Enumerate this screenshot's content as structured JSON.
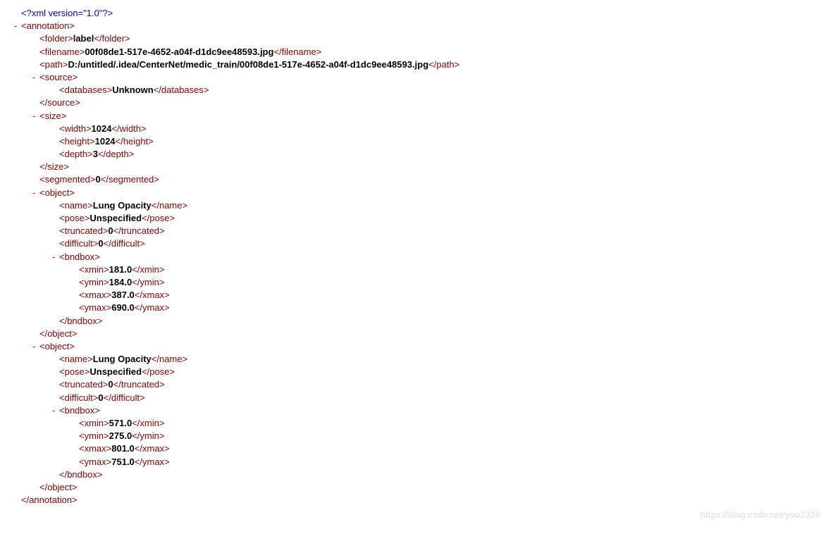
{
  "xml_decl": "<?xml version=\"1.0\"?>",
  "toggle": "-",
  "tags": {
    "annotation_open": "<annotation>",
    "annotation_close": "</annotation>",
    "folder_open": "<folder>",
    "folder_close": "</folder>",
    "filename_open": "<filename>",
    "filename_close": "</filename>",
    "path_open": "<path>",
    "path_close": "</path>",
    "source_open": "<source>",
    "source_close": "</source>",
    "databases_open": "<databases>",
    "databases_close": "</databases>",
    "size_open": "<size>",
    "size_close": "</size>",
    "width_open": "<width>",
    "width_close": "</width>",
    "height_open": "<height>",
    "height_close": "</height>",
    "depth_open": "<depth>",
    "depth_close": "</depth>",
    "segmented_open": "<segmented>",
    "segmented_close": "</segmented>",
    "object_open": "<object>",
    "object_close": "</object>",
    "name_open": "<name>",
    "name_close": "</name>",
    "pose_open": "<pose>",
    "pose_close": "</pose>",
    "truncated_open": "<truncated>",
    "truncated_close": "</truncated>",
    "difficult_open": "<difficult>",
    "difficult_close": "</difficult>",
    "bndbox_open": "<bndbox>",
    "bndbox_close": "</bndbox>",
    "xmin_open": "<xmin>",
    "xmin_close": "</xmin>",
    "ymin_open": "<ymin>",
    "ymin_close": "</ymin>",
    "xmax_open": "<xmax>",
    "xmax_close": "</xmax>",
    "ymax_open": "<ymax>",
    "ymax_close": "</ymax>"
  },
  "vals": {
    "folder": "label",
    "filename": "00f08de1-517e-4652-a04f-d1dc9ee48593.jpg",
    "path": "D:/untitled/.idea/CenterNet/medic_train/00f08de1-517e-4652-a04f-d1dc9ee48593.jpg",
    "databases": "Unknown",
    "width": "1024",
    "height": "1024",
    "depth": "3",
    "segmented": "0",
    "obj1": {
      "name": "Lung Opacity",
      "pose": "Unspecified",
      "truncated": "0",
      "difficult": "0",
      "xmin": "181.0",
      "ymin": "184.0",
      "xmax": "387.0",
      "ymax": "690.0"
    },
    "obj2": {
      "name": "Lung Opacity",
      "pose": "Unspecified",
      "truncated": "0",
      "difficult": "0",
      "xmin": "571.0",
      "ymin": "275.0",
      "xmax": "801.0",
      "ymax": "751.0"
    }
  },
  "watermark": "https://blog.csdn.net/you2336"
}
